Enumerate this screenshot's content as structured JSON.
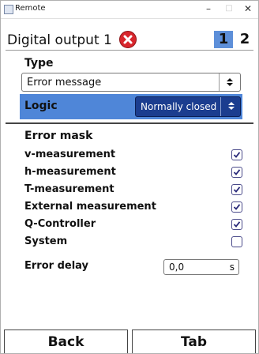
{
  "window": {
    "title": "Remote",
    "minimize": "–",
    "maximize": "□",
    "close": "✕"
  },
  "header": {
    "name": "Digital output 1",
    "error_icon": "error-x-icon",
    "page_active": "1",
    "page_other": "2"
  },
  "type": {
    "label": "Type",
    "value": "Error message"
  },
  "logic": {
    "label": "Logic",
    "value": "Normally closed"
  },
  "error_mask": {
    "label": "Error mask",
    "items": [
      {
        "label": "v-measurement",
        "checked": true
      },
      {
        "label": "h-measurement",
        "checked": true
      },
      {
        "label": "T-measurement",
        "checked": true
      },
      {
        "label": "External measurement",
        "checked": true
      },
      {
        "label": "Q-Controller",
        "checked": true
      },
      {
        "label": "System",
        "checked": false
      }
    ]
  },
  "error_delay": {
    "label": "Error delay",
    "value": "0,0",
    "unit": "s"
  },
  "buttons": {
    "back": "Back",
    "tab": "Tab"
  },
  "colors": {
    "highlight": "#4f86d8",
    "dark_select": "#1b3d8f",
    "page_active_bg": "#5d8fd9",
    "error_red": "#d8262c"
  }
}
